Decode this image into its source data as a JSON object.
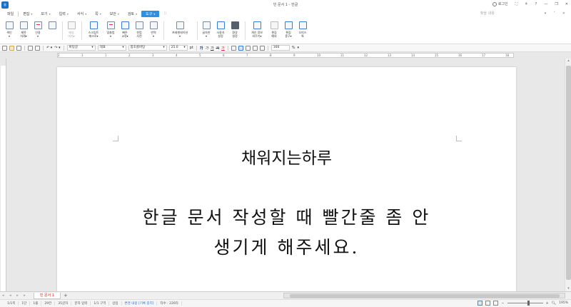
{
  "window": {
    "title": "빈 문서 1 - 한글",
    "app_logo": "ㅎ",
    "login": "로그인",
    "controls": [
      "⛶",
      "⚘",
      "?",
      "—",
      "❐",
      "✕"
    ]
  },
  "menu": {
    "items": [
      {
        "label": "파일",
        "caret": false
      },
      {
        "label": "편집",
        "caret": true
      },
      {
        "label": "보기",
        "caret": true
      },
      {
        "label": "입력",
        "caret": true
      },
      {
        "label": "서식",
        "caret": true
      },
      {
        "label": "쪽",
        "caret": true
      },
      {
        "label": "보안",
        "caret": true
      },
      {
        "label": "검토",
        "caret": true
      },
      {
        "label": "도구",
        "caret": true,
        "active": true
      }
    ],
    "search_placeholder": "찾을 내용",
    "right_icons": [
      "▾",
      "˄",
      "✕"
    ]
  },
  "ribbon": {
    "groups": [
      [
        {
          "name": "index-button",
          "label": "색인\n▾",
          "icon": "index-icon"
        },
        {
          "name": "toc-button",
          "label": "제목\n차례▾",
          "icon": "toc-icon"
        },
        {
          "name": "bind-button",
          "label": "인용\n▾",
          "icon": "quote-icon",
          "style": "red"
        },
        {
          "name": "bookmark-button",
          "label": "",
          "icon": "bookmark-icon"
        }
      ],
      [
        {
          "name": "mail-merge-button",
          "label": "메일\n머지▾",
          "icon": "mail-merge-icon",
          "style": "grey",
          "disabled": true
        }
      ],
      [
        {
          "name": "script-macro-button",
          "label": "스크립트\n매크로▾",
          "icon": "script-macro-icon",
          "wide": true,
          "style": "blue"
        },
        {
          "name": "spell-check-button",
          "label": "맞춤법\n▾",
          "icon": "spell-check-icon",
          "style": "red"
        },
        {
          "name": "quick-correct-button",
          "label": "빠른\n교정▾",
          "icon": "quick-correct-icon",
          "style": "blue"
        },
        {
          "name": "dictionary-button",
          "label": "한컴\n사전",
          "icon": "dictionary-icon"
        },
        {
          "name": "translate-button",
          "label": "번역\n▾",
          "icon": "translate-icon"
        }
      ],
      [
        {
          "name": "presentation-button",
          "label": "프레젠테이션\n▾",
          "icon": "presentation-icon",
          "wide": true,
          "xwide": true
        }
      ],
      [
        {
          "name": "formula-button",
          "label": "글자판\n▾",
          "icon": "keyboard-icon"
        },
        {
          "name": "user-settings-button",
          "label": "사용자\n설정",
          "icon": "user-icon",
          "style": "blue"
        },
        {
          "name": "env-settings-button",
          "label": "환경\n설정",
          "icon": "gear-icon",
          "style": "dark"
        }
      ],
      [
        {
          "name": "personal-info-button",
          "label": "개인 정보\n바꾸기▾",
          "icon": "personal-info-icon",
          "wide": true,
          "style": "blue"
        },
        {
          "name": "edit-window-button",
          "label": "편집\n예외",
          "icon": "edit-window-icon",
          "style": "grey"
        },
        {
          "name": "edit-tool-button",
          "label": "편집\n용구▾",
          "icon": "edit-tool-icon",
          "style": "blue"
        },
        {
          "name": "office-button",
          "label": "오피스\n톡",
          "icon": "office-icon",
          "style": "blue"
        }
      ]
    ]
  },
  "format_toolbar": {
    "undo": "↶ ▾",
    "redo": "↷ ▾",
    "style": "바탕글",
    "language": "대표",
    "font": "함초롬바탕",
    "font_size": "25.0",
    "size_unit": "pt",
    "bold": "가",
    "italic": "가",
    "underline": "가",
    "strike": "가",
    "font_color": "가",
    "line_spacing": "160",
    "line_spacing_unit": "%"
  },
  "ruler": {
    "numbers": [
      "2",
      "1",
      "1",
      "2",
      "3",
      "4",
      "5",
      "6",
      "7",
      "8",
      "9",
      "10",
      "11",
      "12",
      "13",
      "14",
      "15",
      "16",
      "17",
      "18"
    ]
  },
  "document": {
    "title": "채워지는하루",
    "body_lines": [
      "한글 문서 작성할 때 빨간줄 좀 안",
      "생기게 해주세요."
    ]
  },
  "tabs": {
    "nav": "◂ ◂ ▸ ▸",
    "items": [
      "빈 문서 1"
    ],
    "add": "+"
  },
  "statusbar": {
    "items": [
      "1/1쪽",
      "1단",
      "1줄",
      "29칸",
      "35글자",
      "문자 입력",
      "1/1 구역",
      "삽입",
      "변경 내용 [기록 중지]",
      "타수 : 226타"
    ],
    "zoom": "195%"
  }
}
